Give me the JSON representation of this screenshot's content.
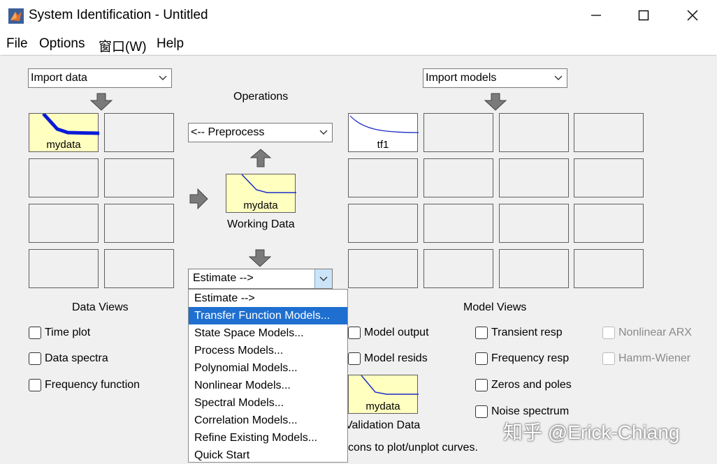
{
  "window": {
    "title": "System Identification - Untitled",
    "controls": {
      "minimize": "minimize-icon",
      "maximize": "maximize-icon",
      "close": "close-icon"
    }
  },
  "menubar": [
    "File",
    "Options",
    "窗口(W)",
    "Help"
  ],
  "data_panel": {
    "import_dropdown": "Import data",
    "slots": [
      "mydata",
      "",
      "",
      "",
      "",
      "",
      "",
      ""
    ],
    "views_label": "Data Views",
    "checkboxes": [
      "Time plot",
      "Data spectra",
      "Frequency function"
    ]
  },
  "operations": {
    "label": "Operations",
    "preprocess_dropdown": "<-- Preprocess",
    "working_data": {
      "name": "mydata",
      "caption": "Working Data"
    },
    "estimate_dropdown": "Estimate -->",
    "estimate_menu": {
      "options": [
        "Estimate -->",
        "Transfer Function Models...",
        "State Space Models...",
        "Process Models...",
        "Polynomial Models...",
        "Nonlinear Models...",
        "Spectral Models...",
        "Correlation Models...",
        "Refine Existing Models...",
        "Quick Start"
      ],
      "selected": "Transfer Function Models..."
    }
  },
  "model_panel": {
    "import_dropdown": "Import models",
    "slots": [
      "tf1",
      "",
      "",
      "",
      "",
      "",
      "",
      "",
      "",
      "",
      "",
      "",
      "",
      "",
      "",
      ""
    ],
    "views_label": "Model Views",
    "checkboxes": {
      "col1": [
        "Model output",
        "Model resids"
      ],
      "col2": [
        "Transient resp",
        "Frequency resp",
        "Zeros and poles",
        "Noise spectrum"
      ],
      "col3": [
        "Nonlinear ARX",
        "Hamm-Wiener"
      ]
    },
    "validation_data": {
      "name": "mydata",
      "caption": "Validation Data"
    },
    "hint": "cons to plot/unplot curves."
  },
  "watermark": "知乎 @Erick-Chiang",
  "colors": {
    "slot_fill": "#ffffc0",
    "selection": "#1e6fd0",
    "curve_thick": "#0a1ad8",
    "curve_thin": "#1a2ac8",
    "arrow_gray": "#7a7a7a"
  }
}
